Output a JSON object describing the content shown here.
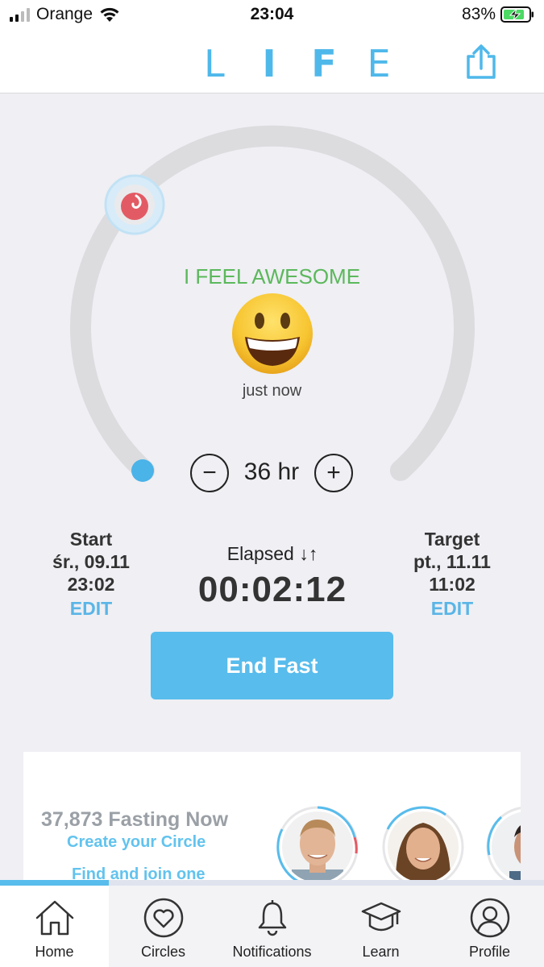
{
  "status_bar": {
    "carrier": "Orange",
    "time": "23:04",
    "battery": "83%"
  },
  "header": {
    "logo_letters": [
      "L",
      "I",
      "F",
      "E"
    ],
    "share_icon": "share-icon"
  },
  "timer": {
    "mood_label": "I FEEL AWESOME",
    "mood_emoji": "grinning-face",
    "mood_time": "just now",
    "progress_fraction": 0.0006,
    "duration": "36 hr",
    "minus_label": "−",
    "plus_label": "+"
  },
  "start": {
    "title": "Start",
    "date": "śr., 09.11",
    "time": "23:02",
    "edit": "EDIT"
  },
  "elapsed": {
    "title": "Elapsed ↓↑",
    "value": "00:02:12"
  },
  "target": {
    "title": "Target",
    "date": "pt., 11.11",
    "time": "11:02",
    "edit": "EDIT"
  },
  "end_button": "End Fast",
  "circle_card": {
    "fasting_now": "37,873 Fasting Now",
    "create_link": "Create your Circle",
    "find_link": "Find and join one"
  },
  "tabs": [
    {
      "label": "Home",
      "icon": "home-icon",
      "active": true
    },
    {
      "label": "Circles",
      "icon": "heart-circle-icon",
      "active": false
    },
    {
      "label": "Notifications",
      "icon": "bell-icon",
      "active": false
    },
    {
      "label": "Learn",
      "icon": "graduation-cap-icon",
      "active": false
    },
    {
      "label": "Profile",
      "icon": "user-icon",
      "active": false
    }
  ],
  "colors": {
    "accent": "#58bcec",
    "mood_green": "#5cb85c",
    "background": "#efeff4"
  }
}
